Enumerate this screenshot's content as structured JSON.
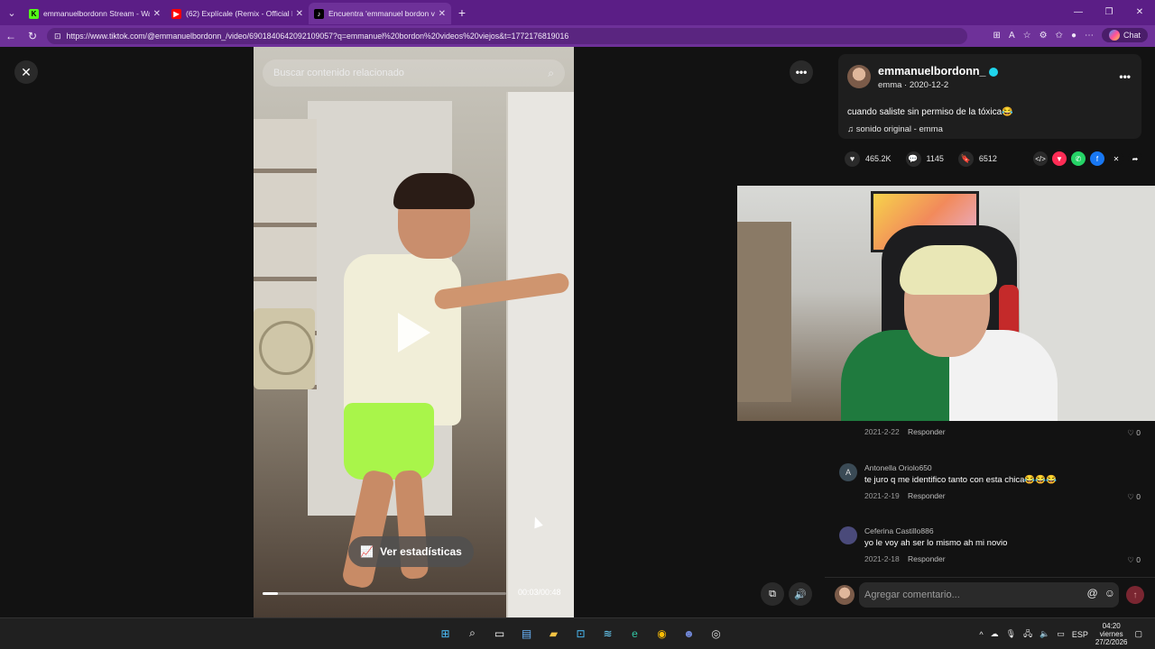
{
  "browser": {
    "tabs": [
      {
        "title": "emmanuelbordonn Stream - Watc",
        "favicon": "kick-icon",
        "active": false
      },
      {
        "title": "(62) Explícale (Remix - Official Lyric",
        "favicon": "youtube-icon",
        "active": false
      },
      {
        "title": "Encuentra 'emmanuel bordon vide",
        "favicon": "tiktok-icon",
        "active": true
      }
    ],
    "url": "https://www.tiktok.com/@emmanuelbordonn_/video/6901840642092109057?q=emmanuel%20bordon%20videos%20viejos&t=1772176819016",
    "chat_label": "Chat"
  },
  "video": {
    "search_placeholder": "Buscar contenido relacionado",
    "stats_label": "Ver estadísticas",
    "time": "00:03/00:48",
    "progress": 0.0625
  },
  "post": {
    "author": "emmanuelbordonn_",
    "meta": "emma · 2020-12-2",
    "caption": "cuando saliste sin permiso de la tóxica😂",
    "sound": "sonido original - emma",
    "likes": "465.2K",
    "comments": "1145",
    "saves": "6512"
  },
  "comments": [
    {
      "name": "",
      "text": "",
      "date": "2021-2-22",
      "reply": "Responder",
      "likes": "0",
      "avatar": ""
    },
    {
      "name": "Antonella Oriolo650",
      "text": "te juro q me identifico tanto con esta chica😂😂😂",
      "date": "2021-2-19",
      "reply": "Responder",
      "likes": "0",
      "avatar": "A"
    },
    {
      "name": "Ceferina Castillo886",
      "text": "yo le voy ah ser lo mismo ah mi novio",
      "date": "2021-2-18",
      "reply": "Responder",
      "likes": "0",
      "avatar": ""
    }
  ],
  "comment_input": {
    "placeholder": "Agregar comentario..."
  },
  "taskbar": {
    "lang": "ESP",
    "time": "04:20",
    "day": "viernes",
    "date": "27/2/2026"
  }
}
